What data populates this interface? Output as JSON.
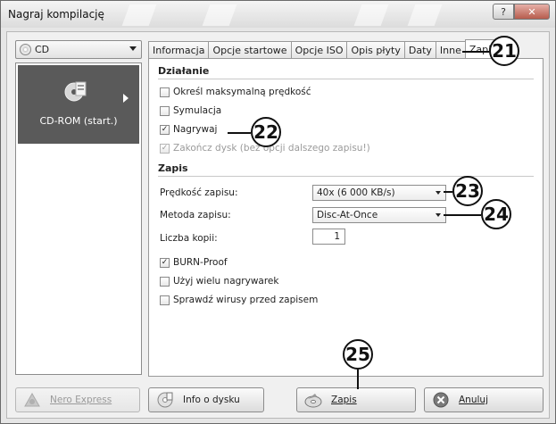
{
  "window": {
    "title": "Nagraj kompilację",
    "help_label": "?",
    "close_label": "✕"
  },
  "left": {
    "dropdown_value": "CD",
    "selected_item_label": "CD-ROM (start.)"
  },
  "tabs": [
    {
      "label": "Informacja"
    },
    {
      "label": "Opcje startowe"
    },
    {
      "label": "Opcje ISO"
    },
    {
      "label": "Opis płyty"
    },
    {
      "label": "Daty"
    },
    {
      "label": "Inne"
    },
    {
      "label": "Zapis",
      "active": true
    }
  ],
  "dzialanie": {
    "title": "Działanie",
    "options": [
      {
        "label": "Określ maksymalną prędkość",
        "checked": false,
        "disabled": false
      },
      {
        "label": "Symulacja",
        "checked": false,
        "disabled": false
      },
      {
        "label": "Nagrywaj",
        "checked": true,
        "disabled": false
      },
      {
        "label": "Zakończ dysk (bez opcji dalszego zapisu!)",
        "checked": true,
        "disabled": true
      }
    ]
  },
  "zapis": {
    "title": "Zapis",
    "speed_label": "Prędkość zapisu:",
    "speed_value": "40x (6 000 KB/s)",
    "method_label": "Metoda zapisu:",
    "method_value": "Disc-At-Once",
    "copies_label": "Liczba kopii:",
    "copies_value": "1",
    "options": [
      {
        "label": "BURN-Proof",
        "checked": true
      },
      {
        "label": "Użyj wielu nagrywarek",
        "checked": false
      },
      {
        "label": "Sprawdź wirusy przed zapisem",
        "checked": false
      }
    ]
  },
  "buttons": {
    "nero_express": "Nero Express",
    "info": "Info o dysku",
    "zapis": "Zapis",
    "anuluj": "Anuluj"
  },
  "callouts": {
    "c21": "21",
    "c22": "22",
    "c23": "23",
    "c24": "24",
    "c25": "25"
  }
}
